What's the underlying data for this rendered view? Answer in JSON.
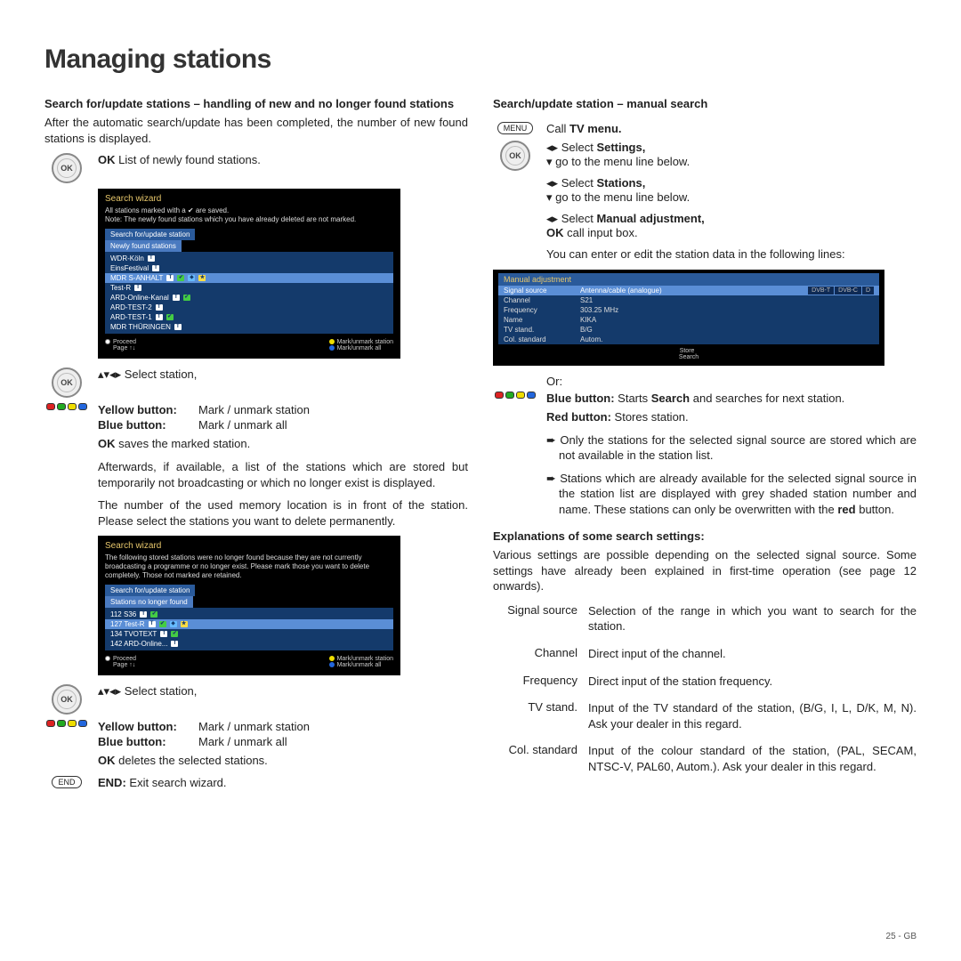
{
  "title": "Managing stations",
  "left": {
    "heading1": "Search for/update stations – handling of new and no longer found stations",
    "para1": "After the automatic search/update has been completed, the number of new found stations is displayed.",
    "ok_list": "OK",
    "ok_list_text": "List of newly found stations.",
    "ss1": {
      "title": "Search wizard",
      "note": "All stations marked with a ✔ are saved.\nNote: The newly found stations which you have already deleted are not marked.",
      "tab1": "Search for/update station",
      "tab2": "Newly found stations",
      "rows": [
        "WDR-Köln",
        "EinsFestival",
        "MDR S-ANHALT",
        "Test-R",
        "ARD-Online-Kanal",
        "ARD-TEST-2",
        "ARD-TEST-1",
        "MDR THÜRINGEN"
      ],
      "f1a": "Proceed",
      "f1b": "Page ↑↓",
      "f2a": "Mark/unmark station",
      "f2b": "Mark/unmark all"
    },
    "select_station": "Select station,",
    "yellow_label": "Yellow button:",
    "yellow_text": "Mark / unmark station",
    "blue_label": "Blue button:",
    "blue_text": "Mark / unmark all",
    "ok_saves": "OK",
    "ok_saves_text": "saves the marked station.",
    "para2": "Afterwards, if available, a list of the stations which are stored but temporarily not broadcasting or which no longer exist is displayed.",
    "para3": "The number of the used memory location is in front of the station. Please select the stations you want to delete permanently.",
    "ss2": {
      "title": "Search wizard",
      "note": "The following stored stations were no longer found because they are not currently broadcasting a programme or no longer exist. Please mark those you want to delete completely. Those not marked are retained.",
      "tab1": "Search for/update station",
      "tab2": "Stations no longer found",
      "rows": [
        "112  S36",
        "127  Test-R",
        "134  TVOTEXT",
        "142  ARD-Online..."
      ],
      "f1a": "Proceed",
      "f1b": "Page ↑↓",
      "f2a": "Mark/unmark station",
      "f2b": "Mark/unmark all"
    },
    "yellow2_label": "Yellow button:",
    "yellow2_text": "Mark / unmark station",
    "blue2_label": "Blue button:",
    "blue2_text": "Mark / unmark all",
    "ok_del": "OK",
    "ok_del_text": "deletes the selected stations.",
    "end_label": "END:",
    "end_text": "Exit search wizard."
  },
  "right": {
    "heading1": "Search/update station – manual search",
    "menu_btn": "MENU",
    "menu_text": "Call ",
    "menu_bold": "TV menu.",
    "sel_settings": "Select ",
    "bold_settings": "Settings,",
    "go_below": "go to the menu line below.",
    "sel_stations": "Select ",
    "bold_stations": "Stations,",
    "sel_manual": "Select ",
    "bold_manual": "Manual adjustment,",
    "ok_call": "OK",
    "ok_call_text": "call input box.",
    "para1": "You can enter or edit the station data in the following lines:",
    "ss": {
      "title": "Manual adjustment",
      "rows": [
        {
          "k": "Signal source",
          "v": "Antenna/cable (analogue)"
        },
        {
          "k": "Channel",
          "v": "S21"
        },
        {
          "k": "Frequency",
          "v": "303.25 MHz"
        },
        {
          "k": "Name",
          "v": "KIKA"
        },
        {
          "k": "TV stand.",
          "v": "B/G"
        },
        {
          "k": "Col. standard",
          "v": "Autom."
        }
      ],
      "tabs": [
        "DVB-T",
        "DVB-C",
        "D"
      ],
      "store": "Store",
      "search": "Search"
    },
    "or": "Or:",
    "blue_label": "Blue button:",
    "blue_text": "Starts ",
    "blue_bold": "Search",
    "blue_text2": " and searches for next station.",
    "red_label": "Red button:",
    "red_text": "Stores station.",
    "bullet1": "Only the stations for the selected signal source are stored which are not available in the station list.",
    "bullet2a": "Stations which are already available for the selected signal source in the station list are displayed with grey shaded station number and name. These stations can only be overwritten with the ",
    "bullet2b": "red",
    "bullet2c": " button.",
    "heading2": "Explanations of some search settings:",
    "para2": "Various settings are possible depending on the selected signal source. Some settings have already been explained in first-time operation (see page 12 onwards).",
    "defs": [
      {
        "k": "Signal source",
        "v": "Selection of the range in which you want to search for the station."
      },
      {
        "k": "Channel",
        "v": "Direct input of the channel."
      },
      {
        "k": "Frequency",
        "v": "Direct input of the station frequency."
      },
      {
        "k": "TV stand.",
        "v": "Input of the TV standard of the station, (B/G, I, L, D/K, M, N). Ask your dealer in this regard."
      },
      {
        "k": "Col. standard",
        "v": "Input of the colour standard of the station, (PAL, SECAM, NTSC-V, PAL60, Autom.). Ask your dealer in this regard."
      }
    ]
  },
  "footer": "25 - GB"
}
